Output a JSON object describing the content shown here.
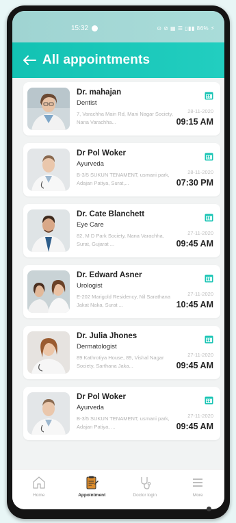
{
  "status_bar": {
    "time": "15:32",
    "right_text": "⊙ ⊘ ▦ ☰ ▯▮▮ 86% ⚡"
  },
  "header": {
    "title": "All appointments"
  },
  "appointments": [
    {
      "name": "Dr. mahajan",
      "specialty": "Dentist",
      "address": "7, Varachha Main Rd, Mani Nagar Society, Nana Varachha...",
      "date": "28-11-2020",
      "time": "09:15 AM"
    },
    {
      "name": "Dr Pol Woker",
      "specialty": "Ayurveda",
      "address": "B-3/5 SUKUN TENAMENT, usmani park, Adajan Patiya, Surat,...",
      "date": "28-11-2020",
      "time": "07:30 PM"
    },
    {
      "name": "Dr. Cate Blanchett",
      "specialty": "Eye Care",
      "address": "82, M D Park Society, Nana Varachha, Surat, Gujarat ...",
      "date": "27-11-2020",
      "time": "09:45 AM"
    },
    {
      "name": "Dr. Edward Asner",
      "specialty": "Urologist",
      "address": "E-202 Marigold Residency, Nil Sarathana Jakat Naka, Surat ...",
      "date": "27-11-2020",
      "time": "10:45 AM"
    },
    {
      "name": "Dr. Julia Jhones",
      "specialty": "Dermatologist",
      "address": "89 Kathrotiya House, 89, Vishal Nagar Society, Sarthana Jaka...",
      "date": "27-11-2020",
      "time": "09:45 AM"
    },
    {
      "name": "Dr Pol Woker",
      "specialty": "Ayurveda",
      "address": "B-3/5 SUKUN TENAMENT, usmani park, Adajan Patiya, ...",
      "date": "27-11-2020",
      "time": "09:45 AM"
    }
  ],
  "nav": {
    "home": "Home",
    "appointment": "Appointment",
    "doctor_login": "Doctor login",
    "more": "More"
  },
  "colors": {
    "accent": "#17c6b8",
    "calendar": "#19c4b4"
  }
}
